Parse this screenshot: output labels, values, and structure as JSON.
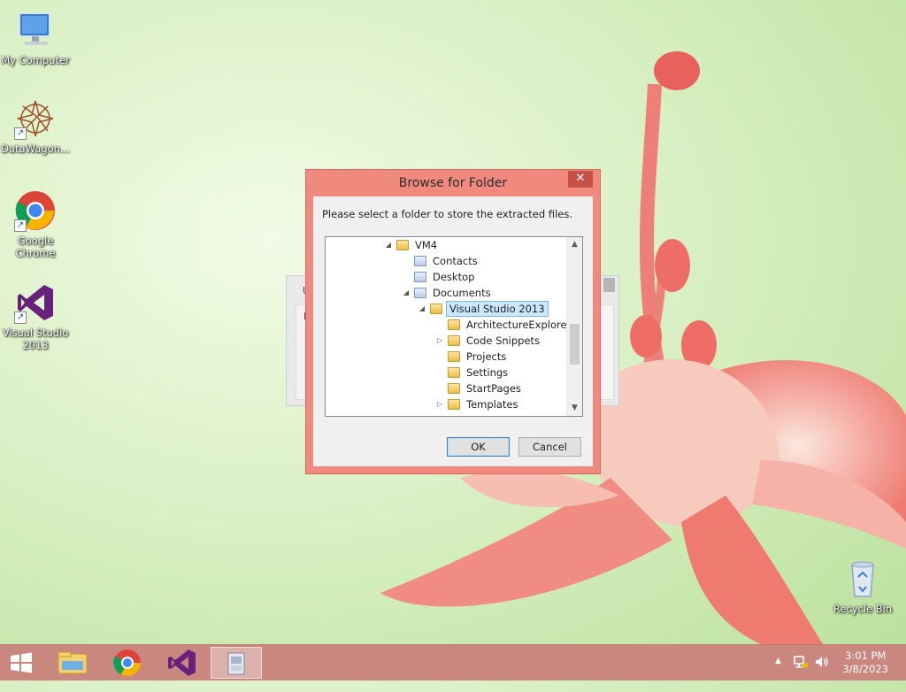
{
  "desktop": {
    "icons": [
      {
        "label": "My Computer",
        "icon": "computer-icon"
      },
      {
        "label": "DataWagon...",
        "icon": "datawagon-icon"
      },
      {
        "label": "Google Chrome",
        "icon": "chrome-icon"
      },
      {
        "label": "Visual Studio 2013",
        "icon": "visual-studio-icon"
      },
      {
        "label": "Recycle Bin",
        "icon": "recycle-bin-icon"
      }
    ]
  },
  "dialog": {
    "title": "Browse for Folder",
    "close_symbol": "✕",
    "prompt": "Please select a folder to store the extracted files.",
    "tree": [
      {
        "label": "VM4",
        "expander": "◢",
        "icon": "folder-icon"
      },
      {
        "label": "Contacts",
        "expander": "",
        "icon": "contacts-folder-icon"
      },
      {
        "label": "Desktop",
        "expander": "",
        "icon": "desktop-folder-icon"
      },
      {
        "label": "Documents",
        "expander": "◢",
        "icon": "documents-folder-icon"
      },
      {
        "label": "Visual Studio 2013",
        "expander": "◢",
        "icon": "folder-icon",
        "selected": true
      },
      {
        "label": "ArchitectureExplorer",
        "expander": "",
        "icon": "folder-icon"
      },
      {
        "label": "Code Snippets",
        "expander": "▷",
        "icon": "folder-icon"
      },
      {
        "label": "Projects",
        "expander": "",
        "icon": "folder-icon"
      },
      {
        "label": "Settings",
        "expander": "",
        "icon": "folder-icon"
      },
      {
        "label": "StartPages",
        "expander": "",
        "icon": "folder-icon"
      },
      {
        "label": "Templates",
        "expander": "▷",
        "icon": "folder-icon"
      }
    ],
    "ok_label": "OK",
    "cancel_label": "Cancel"
  },
  "background_window": {
    "char1": "U",
    "char2": "F"
  },
  "taskbar": {
    "items": [
      {
        "icon": "start-windows-icon"
      },
      {
        "icon": "file-explorer-icon"
      },
      {
        "icon": "chrome-icon"
      },
      {
        "icon": "visual-studio-icon"
      },
      {
        "icon": "installer-app-icon"
      }
    ],
    "tray": {
      "chevron": "▲",
      "time": "3:01 PM",
      "date": "3/8/2023"
    }
  },
  "colors": {
    "dialog_frame": "#f08a7e",
    "close_button": "#c7504a",
    "taskbar": "#c9877f",
    "selection": "#cce8ff"
  }
}
